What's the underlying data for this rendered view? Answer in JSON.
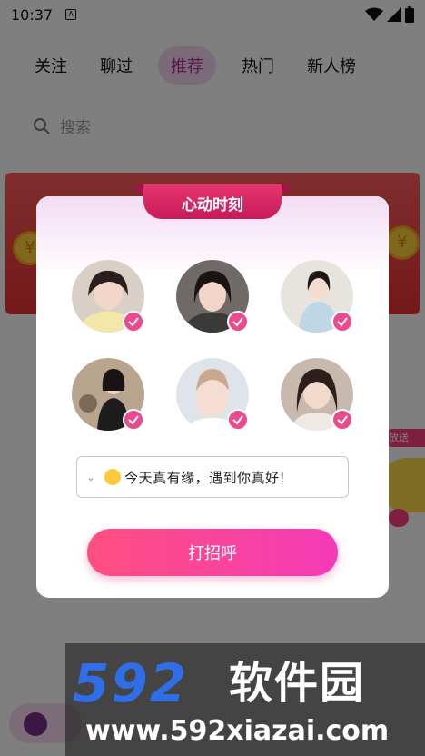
{
  "status_bar": {
    "time": "10:37",
    "app_badge": "A"
  },
  "tabs": [
    {
      "label": "关注"
    },
    {
      "label": "聊过"
    },
    {
      "label": "推荐",
      "active": true
    },
    {
      "label": "热门"
    },
    {
      "label": "新人榜"
    }
  ],
  "search": {
    "placeholder": "搜索"
  },
  "side": {
    "tag": "放送"
  },
  "modal": {
    "ribbon_title": "心动时刻",
    "avatars": [
      {
        "name": "avatar-1",
        "checked": true
      },
      {
        "name": "avatar-2",
        "checked": true
      },
      {
        "name": "avatar-3",
        "checked": true
      },
      {
        "name": "avatar-4",
        "checked": true
      },
      {
        "name": "avatar-5",
        "checked": true
      },
      {
        "name": "avatar-6",
        "checked": true
      }
    ],
    "greeting": "今天真有缘，遇到你真好!",
    "button_label": "打招呼"
  },
  "watermark": {
    "logo": "592",
    "site_name": "软件园",
    "url": "www.592xiazai.com"
  },
  "colors": {
    "accent": "#ec4a8e",
    "ribbon": "#d9245f",
    "button_start": "#ff4f7f",
    "button_end": "#f43ab7"
  }
}
